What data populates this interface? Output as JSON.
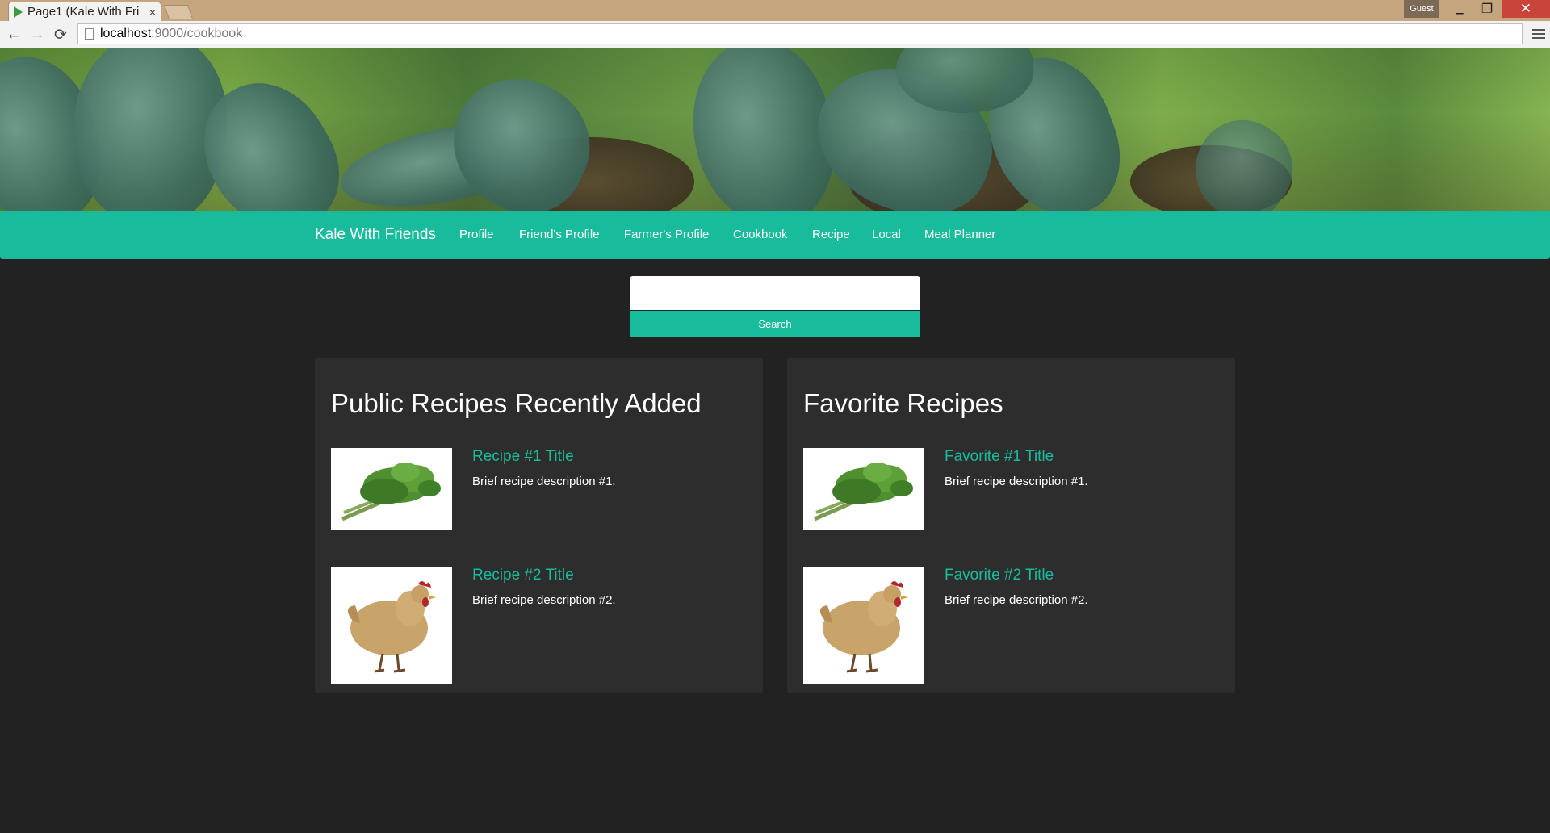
{
  "browser": {
    "tab_title": "Page1 (Kale With Fri",
    "tab_close": "×",
    "profile_badge": "Guest",
    "window_controls": {
      "minimize": "‗",
      "maximize": "❐",
      "close": "✕"
    },
    "url_host": "localhost",
    "url_path": ":9000/cookbook",
    "nav": {
      "back": "←",
      "forward": "→",
      "reload": "⟳"
    }
  },
  "site": {
    "brand": "Kale With Friends",
    "nav_items": [
      "Profile",
      "Friend's Profile",
      "Farmer's Profile",
      "Cookbook",
      "Recipe",
      "Local",
      "Meal Planner"
    ],
    "accent_color": "#18bc9c",
    "background_color": "#222222"
  },
  "search": {
    "input_value": "",
    "button_label": "Search"
  },
  "panels": {
    "public": {
      "title": "Public Recipes Recently Added",
      "items": [
        {
          "title": "Recipe #1 Title",
          "description": "Brief recipe description #1.",
          "image": "kale"
        },
        {
          "title": "Recipe #2 Title",
          "description": "Brief recipe description #2.",
          "image": "chicken"
        }
      ]
    },
    "favorites": {
      "title": "Favorite Recipes",
      "items": [
        {
          "title": "Favorite #1 Title",
          "description": "Brief recipe description #1.",
          "image": "kale"
        },
        {
          "title": "Favorite #2 Title",
          "description": "Brief recipe description #2.",
          "image": "chicken"
        }
      ]
    }
  }
}
